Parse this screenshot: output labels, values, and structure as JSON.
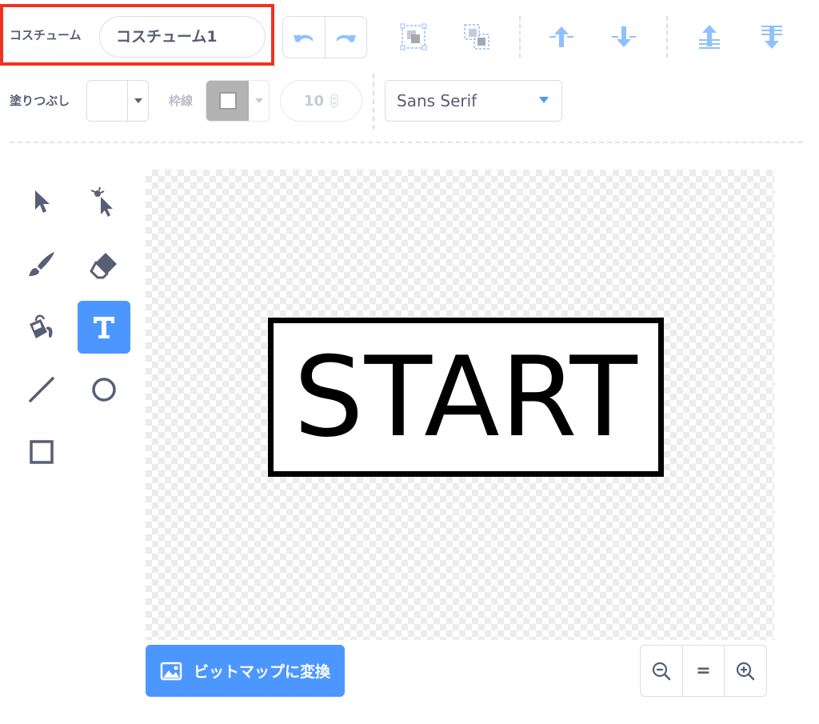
{
  "costume": {
    "label": "コスチューム",
    "name": "コスチューム1"
  },
  "fill": {
    "label": "塗りつぶし"
  },
  "outline": {
    "label": "枠線",
    "width": "10"
  },
  "font": {
    "selected": "Sans Serif"
  },
  "canvas": {
    "text": "START"
  },
  "convert": {
    "label": "ビットマップに変換"
  },
  "zoom": {
    "reset_label": "="
  },
  "icons": {
    "undo": "undo-icon",
    "redo": "redo-icon",
    "group": "group-icon",
    "ungroup": "ungroup-icon",
    "forward": "forward-icon",
    "backward": "backward-icon",
    "front": "front-icon",
    "back": "back-icon",
    "select": "select-icon",
    "reshape": "reshape-icon",
    "brush": "brush-icon",
    "eraser": "eraser-icon",
    "fill": "fill-icon",
    "text": "text-icon",
    "line": "line-icon",
    "circle": "circle-icon",
    "rectangle": "rectangle-icon",
    "bitmap": "image-icon",
    "zoom_out": "zoom-out-icon",
    "zoom_in": "zoom-in-icon"
  },
  "colors": {
    "accent": "#4c97ff",
    "icon": "#575e75",
    "highlight": "#ee3322"
  }
}
